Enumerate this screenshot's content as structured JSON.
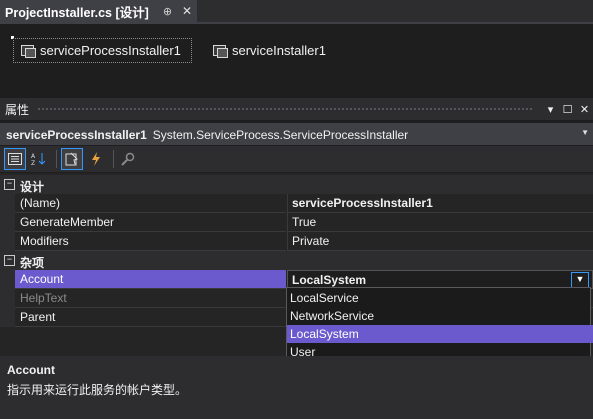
{
  "tab": {
    "title": "ProjectInstaller.cs [设计]",
    "pin": "⊕",
    "close": "✕"
  },
  "designer": {
    "components": [
      {
        "label": "serviceProcessInstaller1"
      },
      {
        "label": "serviceInstaller1"
      }
    ]
  },
  "properties": {
    "title": "属性",
    "title_buttons": [
      "▾",
      "☐",
      "✕"
    ],
    "object_name": "serviceProcessInstaller1",
    "object_type": "System.ServiceProcess.ServiceProcessInstaller",
    "categories": [
      {
        "label": "设计",
        "expander": "⊟",
        "props": [
          {
            "name": "(Name)",
            "value": "serviceProcessInstaller1"
          },
          {
            "name": "GenerateMember",
            "value": "True"
          },
          {
            "name": "Modifiers",
            "value": "Private"
          }
        ]
      },
      {
        "label": "杂项",
        "expander": "⊟",
        "props": [
          {
            "name": "Account",
            "value": "LocalSystem"
          },
          {
            "name": "HelpText",
            "value": ""
          },
          {
            "name": "Parent",
            "value": ""
          }
        ]
      }
    ],
    "dropdown": {
      "options": [
        "LocalService",
        "NetworkService",
        "LocalSystem",
        "User"
      ],
      "highlighted": "LocalSystem"
    },
    "description": {
      "title": "Account",
      "text": "指示用来运行此服务的帐户类型。"
    }
  },
  "colors": {
    "selection": "#6a5acd",
    "accent": "#3399ff",
    "background": "#1e1e1e"
  }
}
